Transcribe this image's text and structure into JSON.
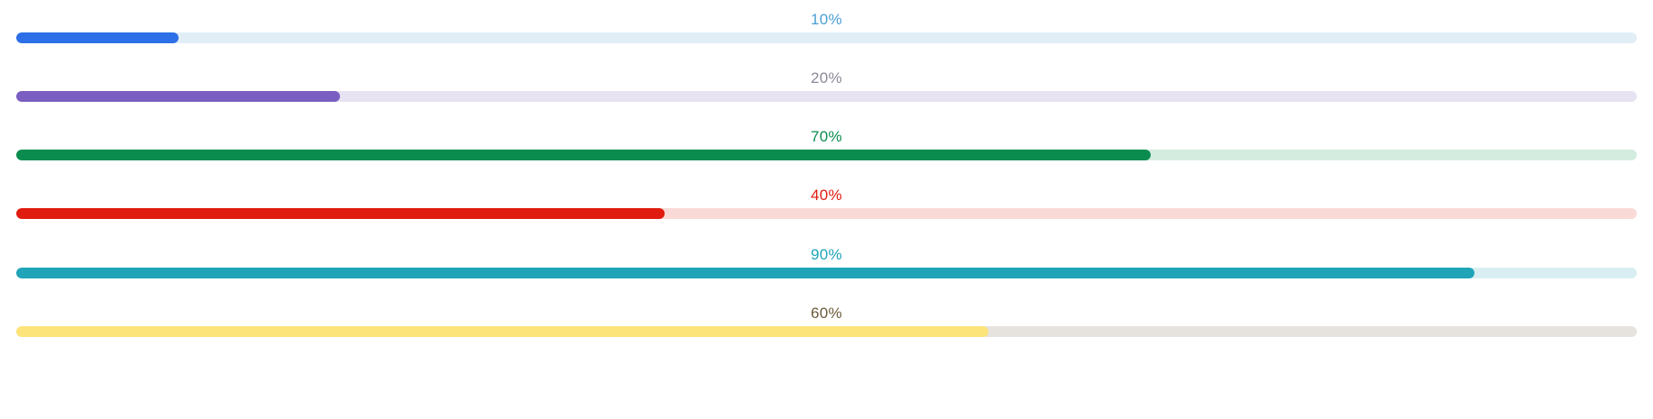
{
  "progress_bars": [
    {
      "label": "10%",
      "value": 0.1,
      "fill_color": "#2c6fe6",
      "track_color": "#e1eef6",
      "label_color": "#4a9fd4"
    },
    {
      "label": "20%",
      "value": 0.2,
      "fill_color": "#7a5ec2",
      "track_color": "#e7e3f3",
      "label_color": "#8a8a9a"
    },
    {
      "label": "70%",
      "value": 0.7,
      "fill_color": "#0a8c4e",
      "track_color": "#d3ecdf",
      "label_color": "#0a8c4e"
    },
    {
      "label": "40%",
      "value": 0.4,
      "fill_color": "#e01b0f",
      "track_color": "#fadad6",
      "label_color": "#e01b0f"
    },
    {
      "label": "90%",
      "value": 0.9,
      "fill_color": "#1fa4b8",
      "track_color": "#d8eef2",
      "label_color": "#1fa4b8"
    },
    {
      "label": "60%",
      "value": 0.6,
      "fill_color": "#fde47a",
      "track_color": "#e6e3df",
      "label_color": "#6b5a3a"
    }
  ]
}
